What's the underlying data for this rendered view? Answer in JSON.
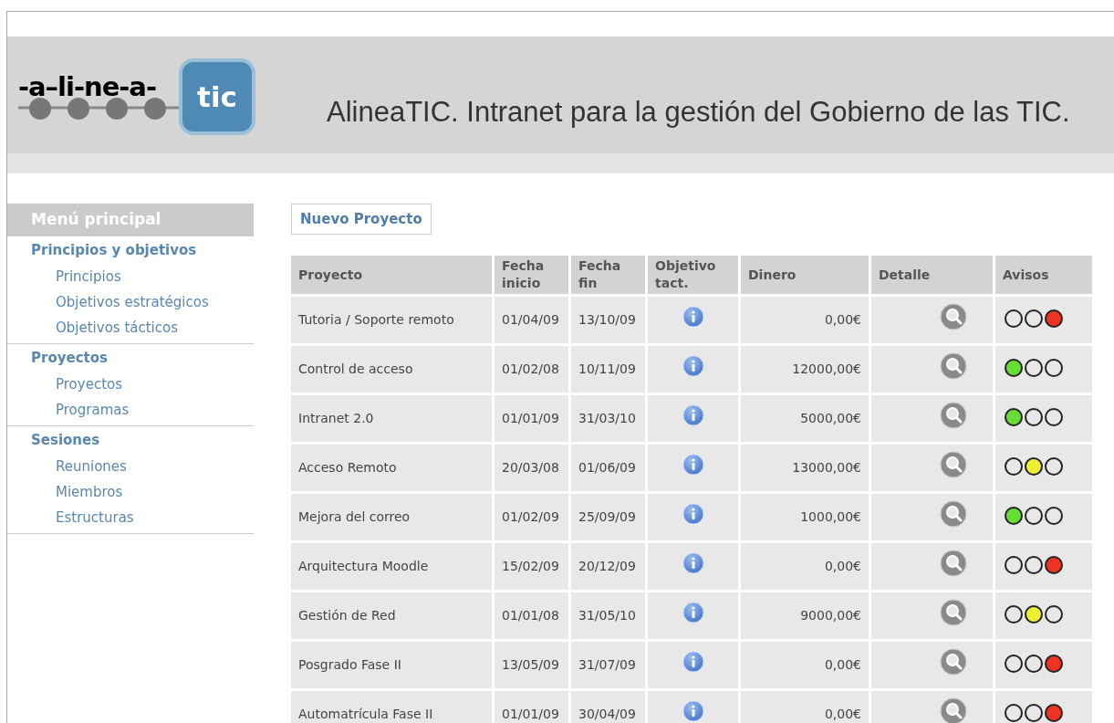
{
  "header": {
    "logo_text": "-a–li-ne-a-",
    "logo_badge": "tic",
    "title": "AlineaTIC. Intranet para la gestión del Gobierno de las TIC."
  },
  "sidebar": {
    "title": "Menú principal",
    "groups": [
      {
        "label": "Principios y objetivos",
        "children": [
          {
            "label": "Principios"
          },
          {
            "label": "Objetivos estratégicos"
          },
          {
            "label": "Objetivos tácticos"
          }
        ]
      },
      {
        "label": "Proyectos",
        "children": [
          {
            "label": "Proyectos"
          },
          {
            "label": "Programas"
          }
        ]
      },
      {
        "label": "Sesiones",
        "children": [
          {
            "label": "Reuniones"
          },
          {
            "label": "Miembros"
          },
          {
            "label": "Estructuras"
          }
        ]
      }
    ]
  },
  "new_button": "Nuevo Proyecto",
  "table": {
    "columns": [
      "Proyecto",
      "Fecha inicio",
      "Fecha fin",
      "Objetivo tact.",
      "Dinero",
      "Detalle",
      "Avisos"
    ],
    "rows": [
      {
        "proyecto": "Tutoria / Soporte remoto",
        "inicio": "01/04/09",
        "fin": "13/10/09",
        "dinero": "0,00€",
        "lights": [
          {
            "on": false
          },
          {
            "on": false
          },
          {
            "on": true,
            "color": "#ee3322"
          }
        ]
      },
      {
        "proyecto": "Control de acceso",
        "inicio": "01/02/08",
        "fin": "10/11/09",
        "dinero": "12000,00€",
        "lights": [
          {
            "on": true,
            "color": "#66dd33"
          },
          {
            "on": false
          },
          {
            "on": false
          }
        ]
      },
      {
        "proyecto": "Intranet 2.0",
        "inicio": "01/01/09",
        "fin": "31/03/10",
        "dinero": "5000,00€",
        "lights": [
          {
            "on": true,
            "color": "#66dd33"
          },
          {
            "on": false
          },
          {
            "on": false
          }
        ]
      },
      {
        "proyecto": "Acceso Remoto",
        "inicio": "20/03/08",
        "fin": "01/06/09",
        "dinero": "13000,00€",
        "lights": [
          {
            "on": false
          },
          {
            "on": true,
            "color": "#eeee33"
          },
          {
            "on": false
          }
        ]
      },
      {
        "proyecto": "Mejora del correo",
        "inicio": "01/02/09",
        "fin": "25/09/09",
        "dinero": "1000,00€",
        "lights": [
          {
            "on": true,
            "color": "#66dd33"
          },
          {
            "on": false
          },
          {
            "on": false
          }
        ]
      },
      {
        "proyecto": "Arquitectura Moodle",
        "inicio": "15/02/09",
        "fin": "20/12/09",
        "dinero": "0,00€",
        "lights": [
          {
            "on": false
          },
          {
            "on": false
          },
          {
            "on": true,
            "color": "#ee3322"
          }
        ]
      },
      {
        "proyecto": "Gestión de Red",
        "inicio": "01/01/08",
        "fin": "31/05/10",
        "dinero": "9000,00€",
        "lights": [
          {
            "on": false
          },
          {
            "on": true,
            "color": "#eeee33"
          },
          {
            "on": false
          }
        ]
      },
      {
        "proyecto": "Posgrado Fase II",
        "inicio": "13/05/09",
        "fin": "31/07/09",
        "dinero": "0,00€",
        "lights": [
          {
            "on": false
          },
          {
            "on": false
          },
          {
            "on": true,
            "color": "#ee3322"
          }
        ]
      },
      {
        "proyecto": "Automatrícula Fase II",
        "inicio": "01/01/09",
        "fin": "30/04/09",
        "dinero": "0,00€",
        "lights": [
          {
            "on": false
          },
          {
            "on": false
          },
          {
            "on": true,
            "color": "#ee3322"
          }
        ]
      }
    ]
  }
}
